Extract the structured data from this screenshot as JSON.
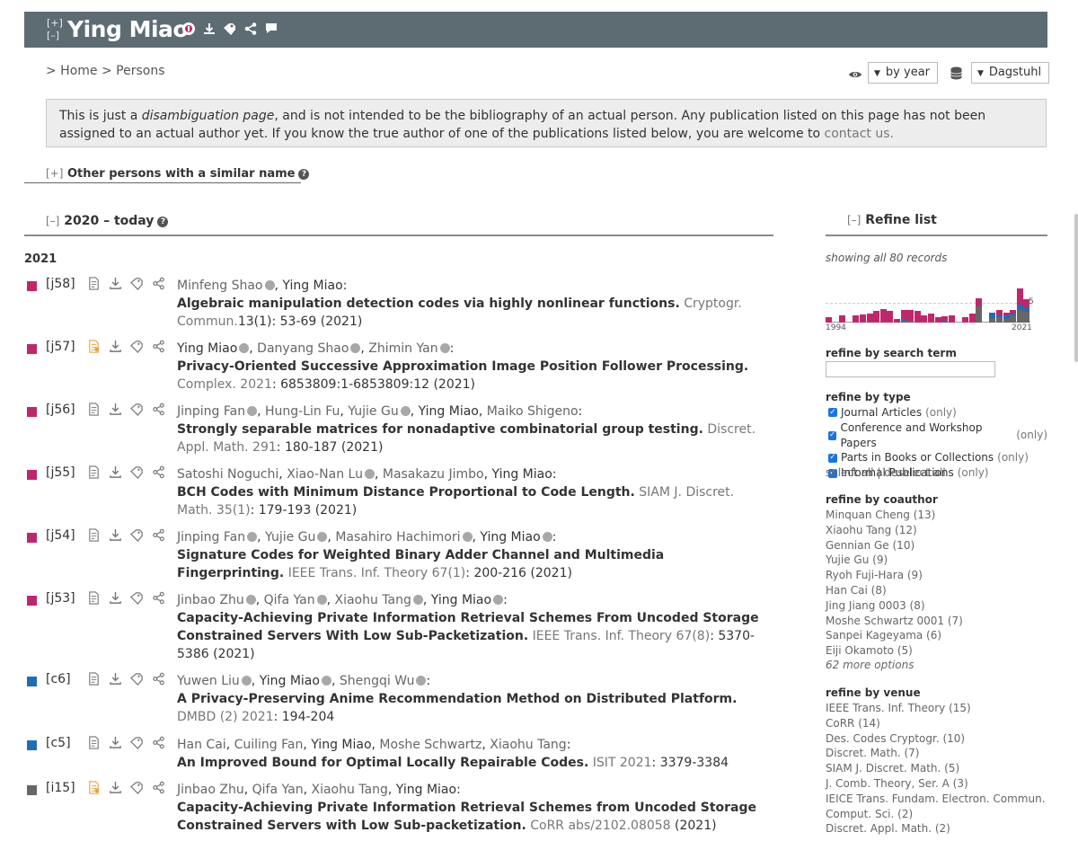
{
  "header": {
    "toggle_open": "[+]",
    "toggle_close": "[–]",
    "name": "Ying Miao",
    "icons": [
      "orcid-icon",
      "download-icon",
      "search-tag-icon",
      "share-icon",
      "comment-icon"
    ]
  },
  "breadcrumb": {
    "text": "> Home > Persons"
  },
  "controls": {
    "view_icon": "eye-icon",
    "order_label": "by year",
    "db_icon": "database-icon",
    "mirror_label": "Dagstuhl"
  },
  "disambiguation": {
    "part1": "This is just a ",
    "emph": "disambiguation page",
    "part2": ", and is not intended to be the bibliography of an actual person. Any publication listed on this page has not been assigned to an actual author yet. If you know the true author of one of the publications listed below, you are welcome to ",
    "link": "contact us",
    "end": "."
  },
  "similar": {
    "toggle": "[+]",
    "label": "Other persons with a similar name"
  },
  "section": {
    "toggle": "[–]",
    "label": "2020 – today"
  },
  "year": "2021",
  "colors": {
    "journal": "#c0276a",
    "conference": "#1f6eb5",
    "informal": "#666666",
    "header": "#5d6b73"
  },
  "entries": [
    {
      "key": "[j58]",
      "type": "journal",
      "authors": [
        {
          "name": "Minfeng Shao",
          "orcid": true
        },
        {
          "name": "Ying Miao",
          "me": true
        }
      ],
      "title": "Algebraic manipulation detection codes via highly nonlinear functions.",
      "venue": "Cryptogr. Commun.",
      "detail": "13(1): 53-69 (2021)"
    },
    {
      "key": "[j57]",
      "type": "journal",
      "oa": true,
      "authors": [
        {
          "name": "Ying Miao",
          "me": true,
          "orcid": true
        },
        {
          "name": "Danyang Shao",
          "orcid": true
        },
        {
          "name": "Zhimin Yan",
          "orcid": true
        }
      ],
      "title": "Privacy-Oriented Successive Approximation Image Position Follower Processing.",
      "venue": "Complex. 2021",
      "detail": ": 6853809:1-6853809:12 (2021)"
    },
    {
      "key": "[j56]",
      "type": "journal",
      "authors": [
        {
          "name": "Jinping Fan",
          "orcid": true
        },
        {
          "name": "Hung-Lin Fu"
        },
        {
          "name": "Yujie Gu",
          "orcid": true
        },
        {
          "name": "Ying Miao",
          "me": true
        },
        {
          "name": "Maiko Shigeno"
        }
      ],
      "title": "Strongly separable matrices for nonadaptive combinatorial group testing.",
      "venue": "Discret. Appl. Math. 291",
      "detail": ": 180-187 (2021)"
    },
    {
      "key": "[j55]",
      "type": "journal",
      "authors": [
        {
          "name": "Satoshi Noguchi"
        },
        {
          "name": "Xiao-Nan Lu",
          "orcid": true
        },
        {
          "name": "Masakazu Jimbo"
        },
        {
          "name": "Ying Miao",
          "me": true
        }
      ],
      "title": "BCH Codes with Minimum Distance Proportional to Code Length.",
      "venue": "SIAM J. Discret. Math. 35(1)",
      "detail": ": 179-193 (2021)"
    },
    {
      "key": "[j54]",
      "type": "journal",
      "authors": [
        {
          "name": "Jinping Fan",
          "orcid": true
        },
        {
          "name": "Yujie Gu",
          "orcid": true
        },
        {
          "name": "Masahiro Hachimori",
          "orcid": true
        },
        {
          "name": "Ying Miao",
          "me": true,
          "orcid": true
        }
      ],
      "title": "Signature Codes for Weighted Binary Adder Channel and Multimedia Fingerprinting.",
      "venue": "IEEE Trans. Inf. Theory 67(1)",
      "detail": ": 200-216 (2021)"
    },
    {
      "key": "[j53]",
      "type": "journal",
      "authors": [
        {
          "name": "Jinbao Zhu",
          "orcid": true
        },
        {
          "name": "Qifa Yan",
          "orcid": true
        },
        {
          "name": "Xiaohu Tang",
          "orcid": true
        },
        {
          "name": "Ying Miao",
          "me": true,
          "orcid": true
        }
      ],
      "title": "Capacity-Achieving Private Information Retrieval Schemes From Uncoded Storage Constrained Servers With Low Sub-Packetization.",
      "venue": "IEEE Trans. Inf. Theory 67(8)",
      "detail": ": 5370-5386 (2021)"
    },
    {
      "key": "[c6]",
      "type": "conference",
      "authors": [
        {
          "name": "Yuwen Liu",
          "orcid": true
        },
        {
          "name": "Ying Miao",
          "me": true,
          "orcid": true
        },
        {
          "name": "Shengqi Wu",
          "orcid": true
        }
      ],
      "title": "A Privacy-Preserving Anime Recommendation Method on Distributed Platform.",
      "venue": "DMBD (2) 2021",
      "detail": ": 194-204"
    },
    {
      "key": "[c5]",
      "type": "conference",
      "authors": [
        {
          "name": "Han Cai"
        },
        {
          "name": "Cuiling Fan"
        },
        {
          "name": "Ying Miao",
          "me": true
        },
        {
          "name": "Moshe Schwartz"
        },
        {
          "name": "Xiaohu Tang"
        }
      ],
      "title": "An Improved Bound for Optimal Locally Repairable Codes.",
      "venue": "ISIT 2021",
      "detail": ": 3379-3384"
    },
    {
      "key": "[i15]",
      "type": "informal",
      "oa": true,
      "authors": [
        {
          "name": "Jinbao Zhu"
        },
        {
          "name": "Qifa Yan"
        },
        {
          "name": "Xiaohu Tang"
        },
        {
          "name": "Ying Miao",
          "me": true
        }
      ],
      "title": "Capacity-Achieving Private Information Retrieval Schemes from Uncoded Storage Constrained Servers with Low Sub-packetization.",
      "venue": "CoRR abs/2102.08058",
      "detail": " (2021)"
    }
  ],
  "refine": {
    "toggle": "[–]",
    "title": "Refine list",
    "showing": "showing all 80 records",
    "chart_start": "1994",
    "chart_end": "2021",
    "chart_mark": "5",
    "search_label": "refine by search term",
    "type_label": "refine by type",
    "types": [
      {
        "label": "Journal Articles",
        "only": "(only)"
      },
      {
        "label": "Conference and Workshop Papers",
        "only": "(only)"
      },
      {
        "label": "Parts in Books or Collections",
        "only": "(only)"
      },
      {
        "label": "Informal Publications",
        "only": "(only)"
      }
    ],
    "select_all": "select all",
    "sep": " | ",
    "deselect_all": "deselect all",
    "coauthor_label": "refine by coauthor",
    "coauthors": [
      "Minquan Cheng (13)",
      "Xiaohu Tang (12)",
      "Gennian Ge (10)",
      "Yujie Gu (9)",
      "Ryoh Fuji-Hara (9)",
      "Han Cai (8)",
      "Jing Jiang 0003 (8)",
      "Moshe Schwartz 0001 (7)",
      "Sanpei Kageyama (6)",
      "Eiji Okamoto (5)"
    ],
    "more_options": "62 more options",
    "venue_label": "refine by venue",
    "venues": [
      "IEEE Trans. Inf. Theory (15)",
      "CoRR (14)",
      "Des. Codes Cryptogr. (10)",
      "Discret. Math. (7)",
      "SIAM J. Discret. Math. (5)",
      "J. Comb. Theory, Ser. A (3)",
      "IEICE Trans. Fundam. Electron. Commun. Comput. Sci. (2)",
      "Discret. Appl. Math. (2)"
    ]
  }
}
